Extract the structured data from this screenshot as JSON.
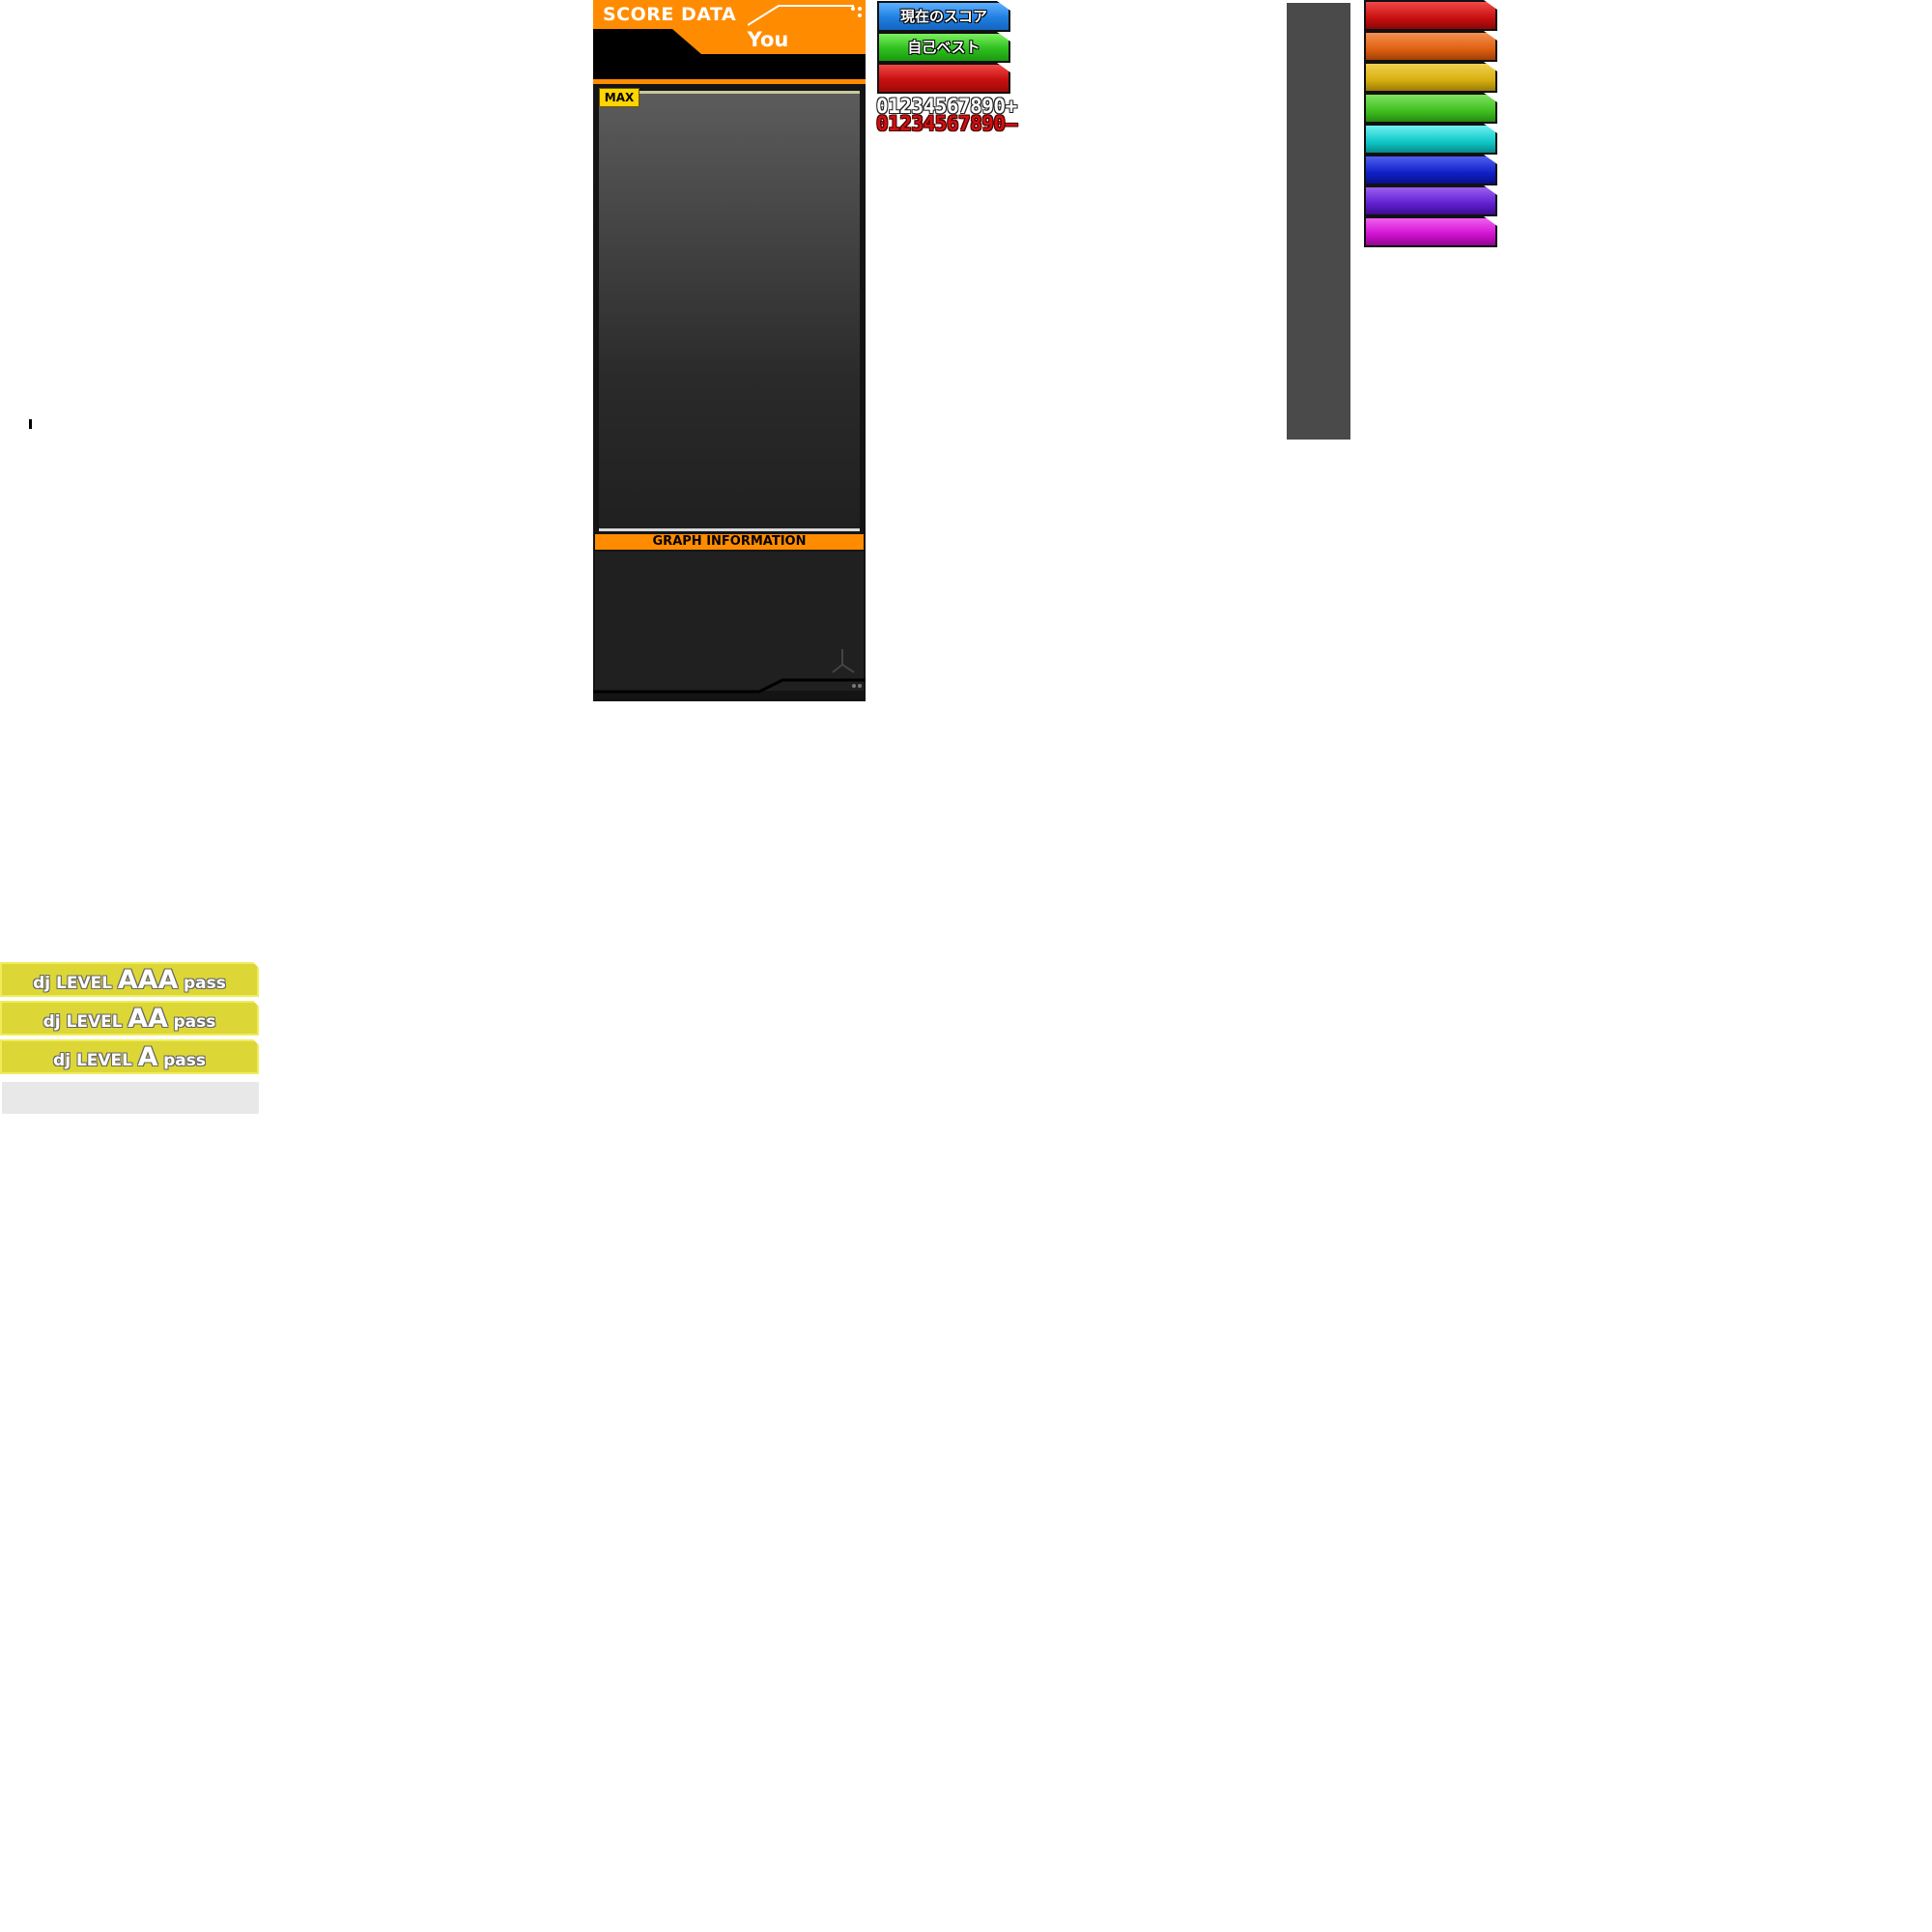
{
  "score_panel": {
    "title": "SCORE DATA",
    "player": "You",
    "max_badge": "MAX",
    "graph_info_label": "GRAPH INFORMATION"
  },
  "buttons": {
    "current_score": "現在のスコア",
    "personal_best": "自己ベスト",
    "red_tab": ""
  },
  "digit_sheets": {
    "white": "01234567890+",
    "red": "01234567890–"
  },
  "colors": {
    "accent_orange": "#ff8c00",
    "tab_blue": "#1f7fe0",
    "tab_green": "#2fbf1f",
    "tab_red": "#c81010",
    "color_tabs": [
      "#c81010",
      "#e06010",
      "#d8b010",
      "#40c020",
      "#10c8c8",
      "#1020c8",
      "#6020d0",
      "#d010d0"
    ],
    "pass_yellow": "#dcd736"
  },
  "dj_levels": [
    {
      "prefix": "dj LEVEL",
      "grade": "AAA",
      "suffix": "pass"
    },
    {
      "prefix": "dj LEVEL",
      "grade": "AA",
      "suffix": "pass"
    },
    {
      "prefix": "dj LEVEL",
      "grade": "A",
      "suffix": "pass"
    }
  ]
}
